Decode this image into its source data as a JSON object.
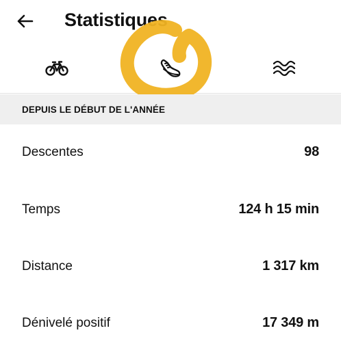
{
  "header": {
    "title": "Statistiques",
    "back_icon": "arrow-left-icon"
  },
  "tabs": [
    {
      "id": "bike",
      "icon": "bike-icon",
      "selected": false
    },
    {
      "id": "run",
      "icon": "running-shoe-icon",
      "selected": true
    },
    {
      "id": "swim",
      "icon": "waves-icon",
      "selected": false
    }
  ],
  "section": {
    "label": "DEPUIS LE DÉBUT DE L'ANNÉE"
  },
  "stats": [
    {
      "label": "Descentes",
      "value": "98"
    },
    {
      "label": "Temps",
      "value": "124 h 15 min"
    },
    {
      "label": "Distance",
      "value": "1 317 km"
    },
    {
      "label": "Dénivelé positif",
      "value": "17 349 m"
    }
  ],
  "colors": {
    "highlight": "#F0B323",
    "section_bg": "#EFEFEF",
    "text": "#111111"
  }
}
